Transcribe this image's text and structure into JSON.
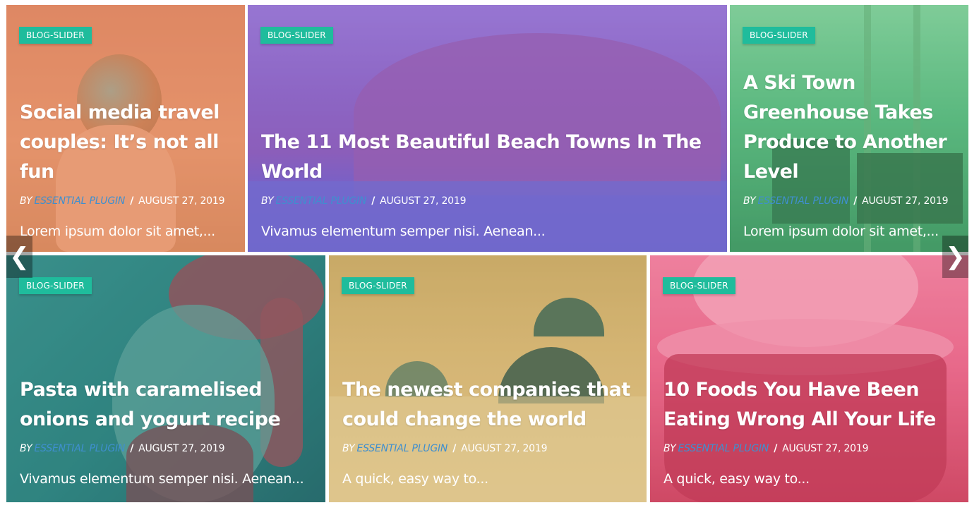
{
  "slider": {
    "prev_icon": "chevron-left-icon",
    "next_icon": "chevron-right-icon",
    "prev_glyph": "❮",
    "next_glyph": "❯"
  },
  "posts": [
    {
      "category": "BLOG-SLIDER",
      "title": "Social media travel couples: It’s not all fun",
      "by": "BY",
      "author": "ESSENTIAL PLUGIN",
      "separator": "/",
      "date": "AUGUST 27, 2019",
      "excerpt": "Lorem ipsum dolor sit amet,...",
      "overlay_color": "#e9875f"
    },
    {
      "category": "BLOG-SLIDER",
      "title": "The 11 Most Beautiful Beach Towns In The World",
      "by": "BY",
      "author": "ESSENTIAL PLUGIN",
      "separator": "/",
      "date": "AUGUST 27, 2019",
      "excerpt": "Vivamus elementum semper nisi. Aenean...",
      "overlay_color": "#8a5cc9"
    },
    {
      "category": "BLOG-SLIDER",
      "title": "A Ski Town Greenhouse Takes Produce to Another Level",
      "by": "BY",
      "author": "ESSENTIAL PLUGIN",
      "separator": "/",
      "date": "AUGUST 27, 2019",
      "excerpt": "Lorem ipsum dolor sit amet,...",
      "overlay_color": "#4fb877"
    },
    {
      "category": "BLOG-SLIDER",
      "title": "Pasta with caramelised onions and yogurt recipe",
      "by": "BY",
      "author": "ESSENTIAL PLUGIN",
      "separator": "/",
      "date": "AUGUST 27, 2019",
      "excerpt": "Vivamus elementum semper nisi. Aenean...",
      "overlay_color": "#2f8e8a"
    },
    {
      "category": "BLOG-SLIDER",
      "title": "The newest companies that could change the world",
      "by": "BY",
      "author": "ESSENTIAL PLUGIN",
      "separator": "/",
      "date": "AUGUST 27, 2019",
      "excerpt": "A quick, easy way to...",
      "overlay_color": "#c9a45c"
    },
    {
      "category": "BLOG-SLIDER",
      "title": "10 Foods You Have Been Eating Wrong All Your Life",
      "by": "BY",
      "author": "ESSENTIAL PLUGIN",
      "separator": "/",
      "date": "AUGUST 27, 2019",
      "excerpt": "A quick, easy way to...",
      "overlay_color": "#e8597e"
    }
  ]
}
